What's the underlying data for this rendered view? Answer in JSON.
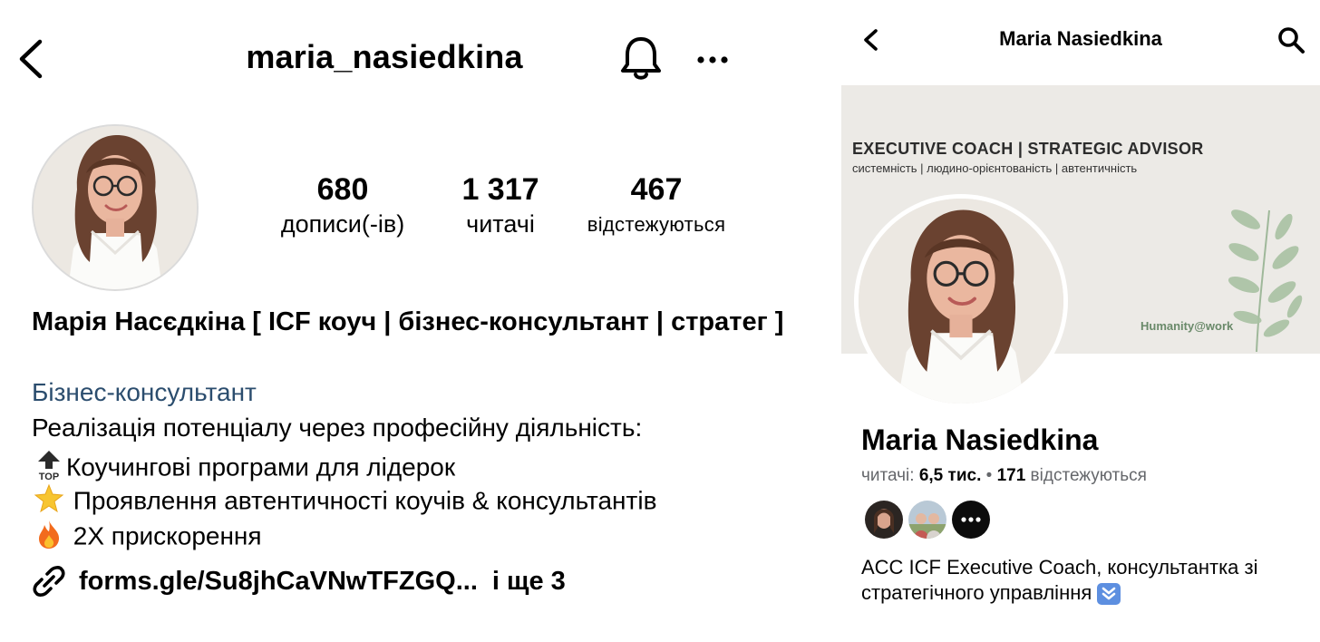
{
  "instagram": {
    "username": "maria_nasiedkina",
    "icons": [
      "back-chevron-icon",
      "bell-icon",
      "more-dots-icon",
      "link-icon"
    ],
    "stats": [
      {
        "value": "680",
        "label": "дописи(-ів)"
      },
      {
        "value": "1 317",
        "label": "читачі"
      },
      {
        "value": "467",
        "label": "відстежуються"
      }
    ],
    "full_name": "Марія Насєдкіна [ ICF коуч | бізнес-консультант | стратег ]",
    "category": "Бізнес-консультант",
    "bio": [
      {
        "emoji": "top-arrow-emoji",
        "text": "Реалізація потенціалу через професійну діяльність:"
      },
      {
        "emoji": "top-arrow-emoji",
        "text": "Коучингові програми для лідерок"
      },
      {
        "emoji": "glowing-star-emoji",
        "text": " Проявлення автентичності коучів & консультантів"
      },
      {
        "emoji": "fire-emoji",
        "text": " 2Х прискорення"
      }
    ],
    "link": "forms.gle/Su8jhCaVNwTFZGQ...",
    "more_links": "і ще 3",
    "colors": {
      "category": "#2b4d6e",
      "avatar_border": "#dbdbdb"
    }
  },
  "facebook": {
    "title": "Maria Nasiedkina",
    "icons": [
      "back-chevron-icon",
      "search-icon",
      "more-dots-icon"
    ],
    "cover": {
      "title": "EXECUTIVE COACH | STRATEGIC ADVISOR",
      "subtitle": "системність | людино-орієнтованість | автентичність",
      "brand": "Humanity@work",
      "colors": {
        "background": "#eceae6",
        "leaves": "#9fb89a",
        "brand": "#6a8a6a"
      }
    },
    "name": "Maria Nasiedkina",
    "followers_label": "читачі: ",
    "followers_value": "6,5 тис.",
    "separator": " • ",
    "following_value": "171",
    "following_label": " відстежуються",
    "bio": "ACC ICF Executive Coach, консультантка зі стратегічного управління",
    "bio_emoji": "down-arrow-emoji",
    "colors": {
      "secondary_text": "#65676b",
      "primary_text": "#050505"
    }
  }
}
